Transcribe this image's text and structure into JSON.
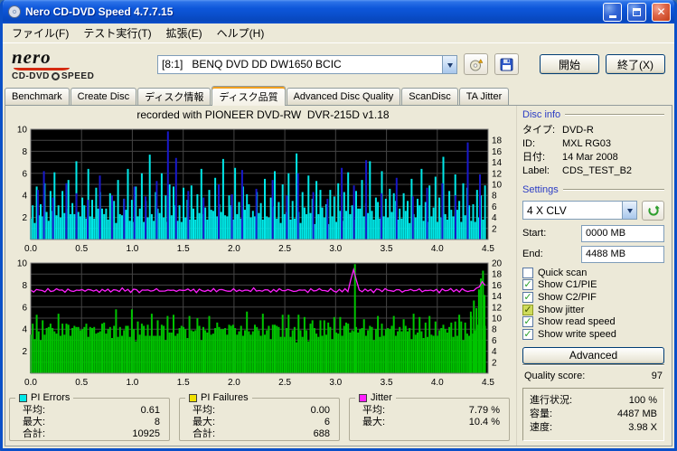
{
  "window": {
    "title": "Nero CD-DVD Speed 4.7.7.15"
  },
  "menu": {
    "items": [
      {
        "label": "ファイル(F)"
      },
      {
        "label": "テスト実行(T)"
      },
      {
        "label": "拡張(E)"
      },
      {
        "label": "ヘルプ(H)"
      }
    ]
  },
  "toolbar": {
    "logo_line1": "nero",
    "logo_line2a": "CD-DVD",
    "logo_line2b": "SPEED",
    "drive": "[8:1]   BENQ DVD DD DW1650 BCIC",
    "start_button": "開始",
    "exit_button": "終了(X)"
  },
  "tabs": [
    {
      "label": "Benchmark",
      "active": false
    },
    {
      "label": "Create Disc",
      "active": false
    },
    {
      "label": "ディスク情報",
      "active": false
    },
    {
      "label": "ディスク品質",
      "active": true
    },
    {
      "label": "Advanced Disc Quality",
      "active": false
    },
    {
      "label": "ScanDisc",
      "active": false
    },
    {
      "label": "TA Jitter",
      "active": false
    }
  ],
  "chart_header": "recorded with PIONEER DVD-RW  DVR-215D v1.18",
  "sidebar": {
    "disc_info": {
      "title": "Disc info",
      "rows": [
        {
          "label": "タイプ:",
          "value": "DVD-R"
        },
        {
          "label": "ID:",
          "value": "MXL RG03"
        },
        {
          "label": "日付:",
          "value": "14 Mar 2008"
        },
        {
          "label": "Label:",
          "value": "CDS_TEST_B2"
        }
      ]
    },
    "settings": {
      "title": "Settings",
      "speed": "4 X CLV",
      "start_label": "Start:",
      "start_value": "0000 MB",
      "end_label": "End:",
      "end_value": "4488 MB",
      "checkboxes": [
        {
          "label": "Quick scan",
          "checked": false,
          "highlight": false
        },
        {
          "label": "Show C1/PIE",
          "checked": true,
          "highlight": false
        },
        {
          "label": "Show C2/PIF",
          "checked": true,
          "highlight": false
        },
        {
          "label": "Show jitter",
          "checked": true,
          "highlight": true
        },
        {
          "label": "Show read speed",
          "checked": true,
          "highlight": false
        },
        {
          "label": "Show write speed",
          "checked": true,
          "highlight": false
        }
      ],
      "advanced_button": "Advanced"
    },
    "quality": {
      "label": "Quality score:",
      "value": "97"
    },
    "progress": {
      "rows": [
        {
          "label": "進行状況:",
          "value": "100 %"
        },
        {
          "label": "容量:",
          "value": "4487 MB"
        },
        {
          "label": "速度:",
          "value": "3.98 X"
        }
      ]
    }
  },
  "stats": {
    "boxes": [
      {
        "title": "PI Errors",
        "color": "#00e8e8",
        "rows": [
          {
            "label": "平均:",
            "value": "0.61"
          },
          {
            "label": "最大:",
            "value": "8"
          },
          {
            "label": "合計:",
            "value": "10925"
          }
        ]
      },
      {
        "title": "PI Failures",
        "color": "#f0e000",
        "rows": [
          {
            "label": "平均:",
            "value": "0.00"
          },
          {
            "label": "最大:",
            "value": "6"
          },
          {
            "label": "合計:",
            "value": "688"
          }
        ]
      },
      {
        "title": "Jitter",
        "color": "#ff20ff",
        "rows": [
          {
            "label": "平均:",
            "value": "7.79 %"
          },
          {
            "label": "最大:",
            "value": "10.4 %"
          }
        ]
      }
    ]
  },
  "chart_data": {
    "type": "line",
    "x_axis_max": 4.5,
    "x_ticks": [
      "0.0",
      "0.5",
      "1.0",
      "1.5",
      "2.0",
      "2.5",
      "3.0",
      "3.5",
      "4.0",
      "4.5"
    ],
    "top": {
      "x_end": 4.47,
      "y_max_left": 10,
      "y_max_right": 20,
      "left_ticks": [
        10,
        8,
        6,
        4,
        2
      ],
      "right_ticks": [
        18,
        16,
        14,
        12,
        10,
        8,
        6,
        4,
        2
      ],
      "series": [
        {
          "name": "pi-errors",
          "type": "bars",
          "color": "#00e8e8",
          "n": 230,
          "base": [
            1.6,
            1.9,
            1.5,
            2.1,
            1.7,
            1.4,
            2.0,
            1.6,
            1.8,
            1.5,
            2.2,
            1.7,
            1.4,
            1.9,
            1.6,
            2.0,
            1.5,
            1.8,
            1.7,
            1.4,
            2.1,
            1.6,
            1.9,
            1.5,
            1.7,
            2.0,
            1.4,
            1.8,
            1.6,
            2.1,
            1.5
          ],
          "noise": [
            0.3,
            1.2,
            0.0,
            2.7,
            0.5,
            1.8,
            0.1,
            3.5,
            0.7,
            0.2,
            2.2,
            0.9,
            4.7,
            0.3,
            1.5,
            0.0,
            2.9,
            0.6,
            1.1,
            4.0,
            0.2,
            1.7,
            0.4,
            5.6,
            0.8,
            0.1,
            2.4,
            1.3,
            0.3,
            4.3,
            0.6,
            2.0,
            0.0,
            3.2,
            0.7,
            2.6,
            1.4
          ]
        },
        {
          "name": "pi-error-peaks",
          "type": "spikes",
          "color": "#1818cc",
          "points": [
            [
              0.07,
              4.5
            ],
            [
              0.13,
              6.2
            ],
            [
              0.22,
              3.8
            ],
            [
              0.35,
              5.1
            ],
            [
              0.45,
              4.2
            ],
            [
              0.56,
              3.6
            ],
            [
              0.68,
              5.8
            ],
            [
              0.8,
              4.0
            ],
            [
              0.92,
              3.7
            ],
            [
              1.02,
              4.8
            ],
            [
              1.13,
              3.9
            ],
            [
              1.24,
              5.3
            ],
            [
              1.35,
              9.8
            ],
            [
              1.43,
              7.4
            ],
            [
              1.55,
              4.4
            ],
            [
              1.7,
              3.8
            ],
            [
              1.85,
              5.0
            ],
            [
              1.98,
              4.1
            ],
            [
              2.08,
              6.3
            ],
            [
              2.22,
              4.6
            ],
            [
              2.38,
              5.4
            ],
            [
              2.52,
              4.0
            ],
            [
              2.63,
              6.0
            ],
            [
              2.78,
              4.3
            ],
            [
              2.92,
              3.7
            ],
            [
              3.06,
              6.5
            ],
            [
              3.18,
              4.9
            ],
            [
              3.3,
              7.2
            ],
            [
              3.45,
              4.2
            ],
            [
              3.6,
              5.6
            ],
            [
              3.76,
              3.9
            ],
            [
              3.9,
              4.7
            ],
            [
              4.05,
              5.1
            ],
            [
              4.18,
              4.0
            ],
            [
              4.3,
              8.8
            ],
            [
              4.42,
              5.9
            ]
          ]
        }
      ]
    },
    "bottom": {
      "x_end": 4.47,
      "y_max_left": 10,
      "y_max_right": 20,
      "left_ticks": [
        10,
        8,
        6,
        4,
        2
      ],
      "right_ticks": [
        20,
        18,
        16,
        14,
        12,
        10,
        8,
        6,
        4,
        2
      ],
      "series": [
        {
          "name": "pi-failures",
          "type": "bars",
          "color": "#00c400",
          "n": 230,
          "base": [
            3.2,
            3.6,
            3.0,
            3.9,
            3.3,
            2.8,
            3.7,
            3.1,
            4.1,
            3.4,
            2.9,
            3.8,
            3.2,
            3.5,
            4.2,
            3.0,
            3.6,
            3.3,
            2.7,
            3.9,
            3.4,
            3.1,
            4.0,
            3.5,
            2.9,
            3.7,
            3.2,
            3.8,
            3.0
          ],
          "noise": [
            0.3,
            0.9,
            0.1,
            1.4,
            0.5,
            0.2,
            1.1,
            0.4,
            0.0,
            0.8,
            1.6,
            0.3,
            0.6,
            0.1,
            1.2,
            0.4,
            0.9,
            0.2,
            1.8,
            0.5,
            0.0,
            1.0,
            0.3,
            0.7,
            1.3,
            0.2,
            0.8,
            0.4,
            1.5,
            0.1,
            0.6,
            1.1,
            0.3
          ]
        },
        {
          "name": "pi-failure-peaks",
          "type": "spikes",
          "color": "#00c400",
          "points": [
            [
              3.19,
              9.9
            ],
            [
              4.33,
              5.6
            ],
            [
              4.36,
              6.6
            ],
            [
              4.385,
              5.9
            ],
            [
              4.41,
              7.6
            ],
            [
              4.43,
              8.6
            ],
            [
              4.45,
              9.3
            ],
            [
              4.465,
              7.1
            ]
          ]
        },
        {
          "name": "jitter",
          "type": "line",
          "color": "#ff20ff",
          "n": 160,
          "base": [
            7.5,
            7.42,
            7.58,
            7.46,
            7.55,
            7.38,
            7.62,
            7.5,
            7.44,
            7.68,
            7.46,
            7.56,
            7.4,
            7.6,
            7.5,
            7.36,
            7.55,
            7.47,
            7.64,
            7.42,
            7.52,
            7.6,
            7.45
          ],
          "noise": [
            0.05,
            -0.06,
            0.02,
            0.08,
            -0.04,
            0.0,
            0.06,
            -0.08,
            0.03,
            -0.02,
            0.07,
            0.0,
            -0.05,
            0.04,
            -0.03,
            0.06,
            -0.01
          ],
          "spikes": [
            [
              3.19,
              9.4
            ],
            [
              4.44,
              8.3
            ]
          ]
        }
      ]
    }
  }
}
